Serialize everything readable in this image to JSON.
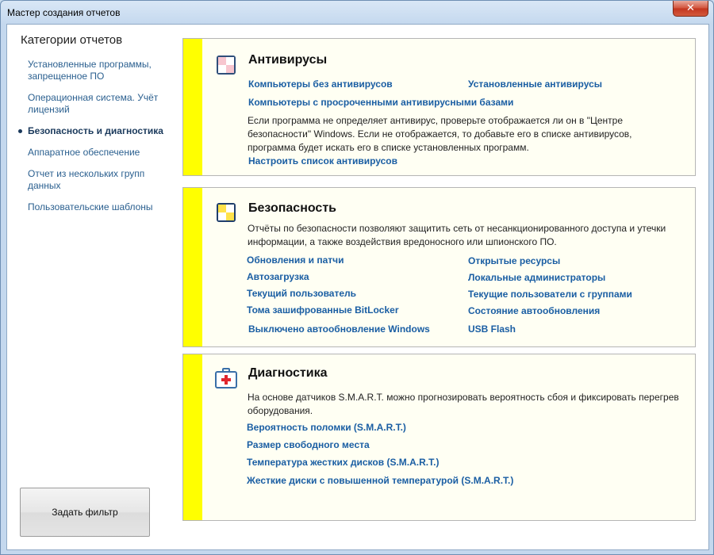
{
  "window": {
    "title": "Мастер создания отчетов",
    "close_label": "✕"
  },
  "sidebar": {
    "heading": "Категории отчетов",
    "items": [
      {
        "label": "Установленные программы, запрещенное ПО"
      },
      {
        "label": "Операционная система. Учёт лицензий"
      },
      {
        "label": "Безопасность и диагностика"
      },
      {
        "label": "Аппаратное обеспечение"
      },
      {
        "label": "Отчет из нескольких групп данных"
      },
      {
        "label": "Пользовательские шаблоны"
      }
    ],
    "active_index": 2,
    "filter_button": "Задать фильтр"
  },
  "antivirus": {
    "title": "Антивирусы",
    "icon": "antivirus-shield-icon",
    "link_no_av": "Компьютеры без антивирусов",
    "link_installed": "Установленные антивирусы",
    "link_outdated": "Компьютеры с просроченными антивирусными базами",
    "description": "Если программа не определяет антивирус, проверьте отображается ли он в \"Центре безопасности\" Windows. Если не отображается, то добавьте его в списке антивирусов, программа будет искать его в списке установленных программ.",
    "link_configure": "Настроить список антивирусов"
  },
  "security": {
    "title": "Безопасность",
    "icon": "security-shield-icon",
    "description": "Отчёты по безопасности позволяют защитить сеть от несанкционированного доступа и утечки информации, а также воздействия вредоносного или шпионского ПО.",
    "links_left": [
      "Обновления и патчи",
      "Автозагрузка",
      "Текущий пользователь",
      "Тома зашифрованные BitLocker",
      "Выключено автообновление Windows"
    ],
    "links_right": [
      "Открытые ресурсы",
      "Локальные администраторы",
      "Текущие пользователи с группами",
      "Состояние автообновления",
      "USB Flash"
    ]
  },
  "diagnostics": {
    "title": "Диагностика",
    "icon": "first-aid-kit-icon",
    "description": "На основе датчиков S.M.A.R.T. можно прогнозировать вероятность сбоя и фиксировать перегрев оборудования.",
    "links": [
      "Вероятность поломки (S.M.A.R.T.)",
      "Размер свободного места",
      "Температура жестких дисков (S.M.A.R.T.)",
      "Жесткие диски с повышенной температурой (S.M.A.R.T.)"
    ]
  },
  "colors": {
    "link": "#1a5ea3",
    "stripe": "#ffff00",
    "panel_bg": "#fffff3"
  }
}
